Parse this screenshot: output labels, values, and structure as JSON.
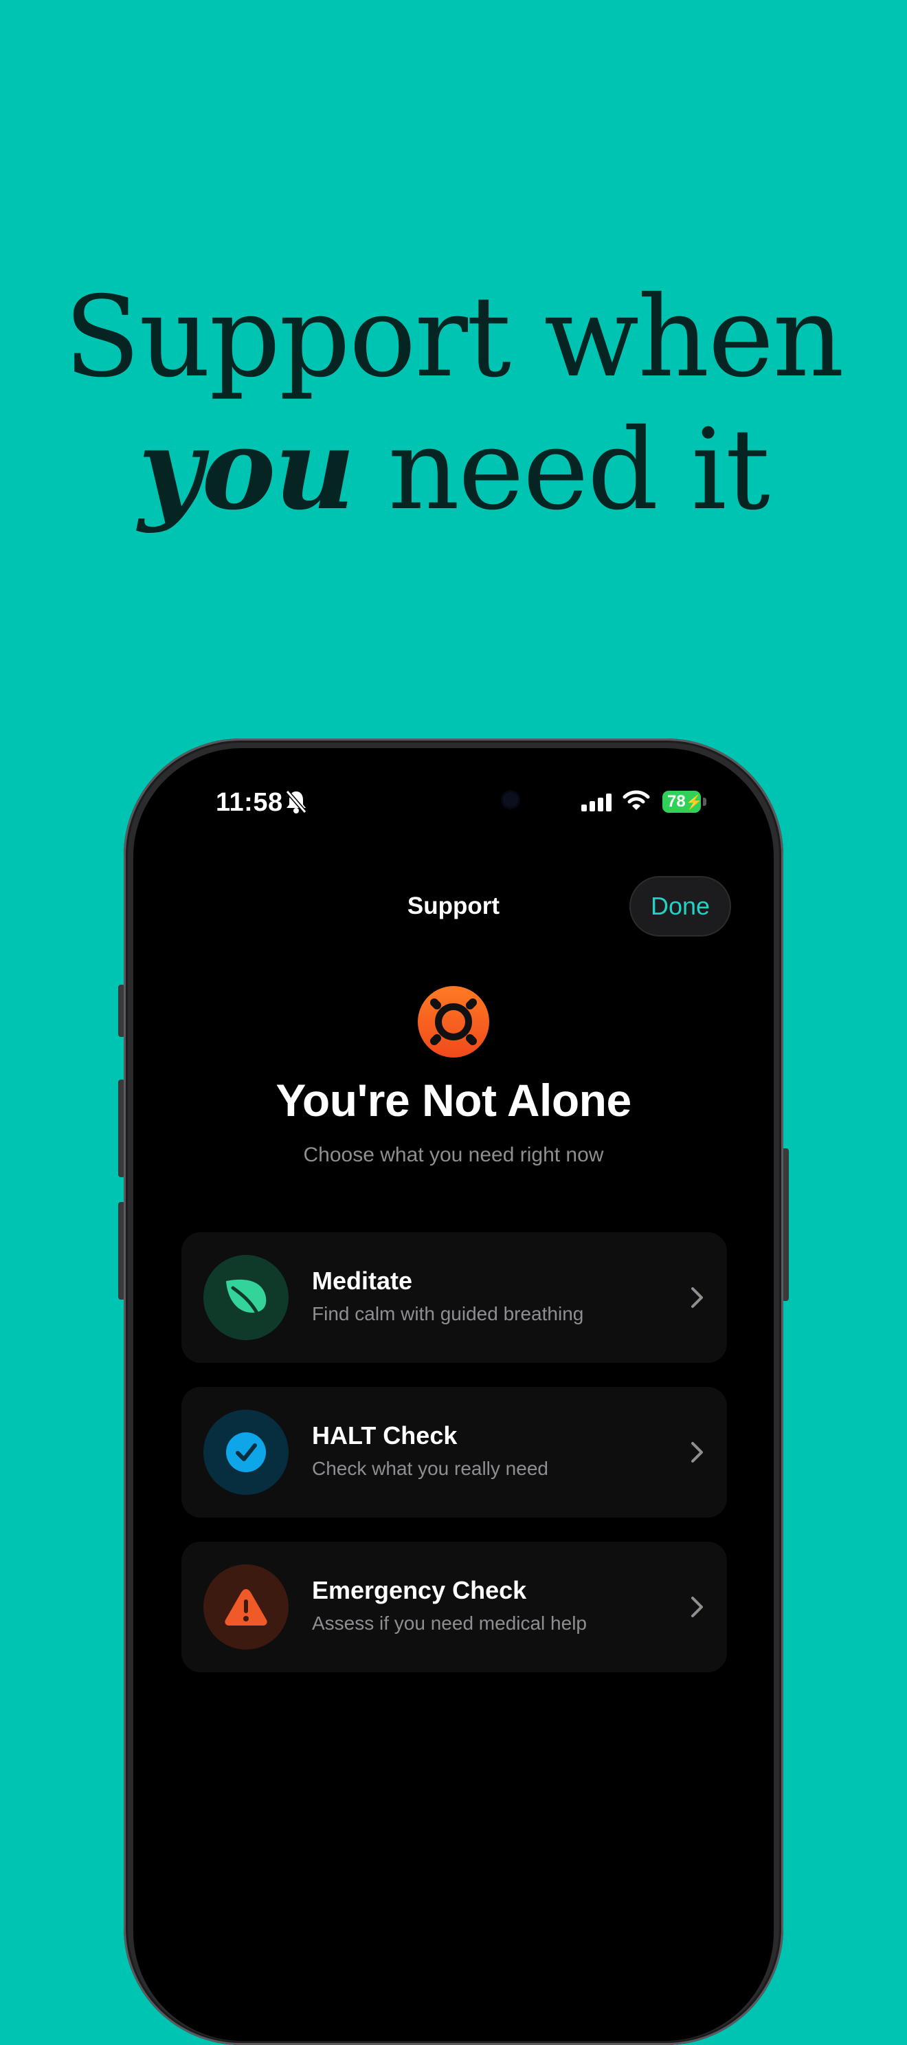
{
  "headline": {
    "line1": "Support when",
    "emphasis": "you",
    "line2_rest": " need it"
  },
  "status_bar": {
    "time": "11:58",
    "battery": "78",
    "icons": [
      "bell-slash-icon",
      "signal-icon",
      "wifi-icon",
      "battery-charging-icon"
    ]
  },
  "nav": {
    "title": "Support",
    "done_label": "Done"
  },
  "hero": {
    "icon": "lifebuoy-icon",
    "title": "You're Not Alone",
    "subtitle": "Choose what you need right now"
  },
  "options": [
    {
      "title": "Meditate",
      "description": "Find calm with guided breathing",
      "icon": "leaf-icon",
      "color": "#34D399"
    },
    {
      "title": "HALT Check",
      "description": "Check what you really need",
      "icon": "checkmark-circle-icon",
      "color": "#0EA5E9"
    },
    {
      "title": "Emergency Check",
      "description": "Assess if you need medical help",
      "icon": "warning-triangle-icon",
      "color": "#F05A28"
    }
  ],
  "colors": {
    "background": "#00C4B2",
    "accent": "#22D3C4",
    "headline": "#062421"
  }
}
